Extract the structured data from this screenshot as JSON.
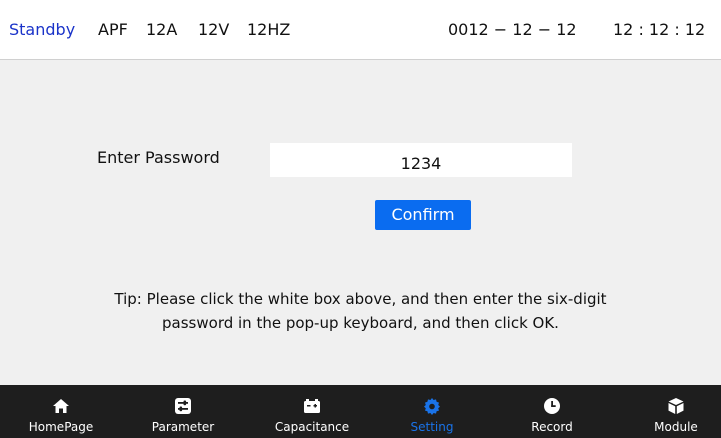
{
  "status": {
    "mode": "Standby",
    "device": "APF",
    "current": "12A",
    "voltage": "12V",
    "frequency": "12HZ",
    "date": "0012 − 12 − 12",
    "time": "12 : 12 : 12",
    "mode_color": "#1a33c9"
  },
  "form": {
    "password_label": "Enter Password",
    "password_value": "1234",
    "confirm_label": "Confirm",
    "tip_line1": "Tip: Please click the white box above, and then enter the six-digit",
    "tip_line2": "password in the pop-up keyboard, and then click OK."
  },
  "nav": {
    "active": "Setting",
    "active_color": "#1a73e8",
    "items": [
      {
        "label": "HomePage",
        "icon": "home-icon"
      },
      {
        "label": "Parameter",
        "icon": "sliders-icon"
      },
      {
        "label": "Capacitance",
        "icon": "battery-icon"
      },
      {
        "label": "Setting",
        "icon": "gear-icon"
      },
      {
        "label": "Record",
        "icon": "clock-icon"
      },
      {
        "label": "Module",
        "icon": "cube-icon"
      }
    ]
  },
  "colors": {
    "background": "#f0f0f0",
    "navbar": "#1e1e1e",
    "button": "#0a6cf0"
  }
}
